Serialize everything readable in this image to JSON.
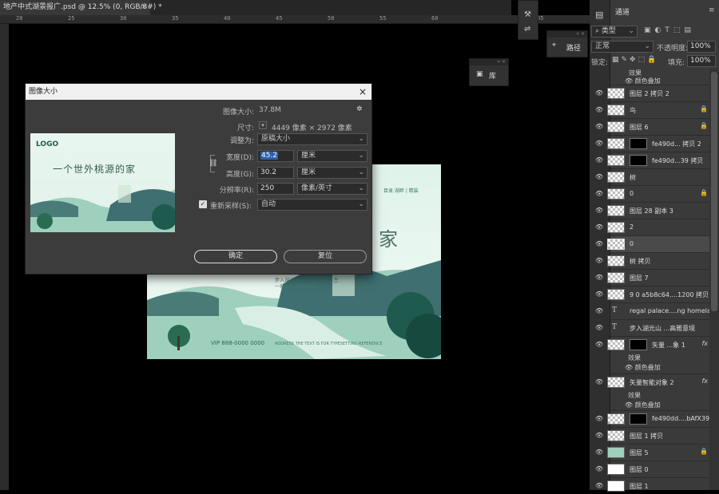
{
  "document": {
    "tab_title": "地产中式湖景报广.psd @ 12.5% (0, RGB/8#) *",
    "tab_close": "×",
    "ruler_ticks": [
      "20",
      "25",
      "30",
      "35",
      "40",
      "45",
      "50",
      "55",
      "60",
      "65"
    ],
    "artwork": {
      "title_char": "家",
      "small_lines": [
        "步入湖光山色间 尽享诗意人生",
        "一城山水 半城湖光"
      ],
      "vip_text": "VIP 888-0000 0000",
      "footer": "ADDRESS THE TEXT IS FOR TYPESETTING REFERENCE",
      "side": "目录 湖畔 | 精装"
    }
  },
  "dialog": {
    "title": "图像大小",
    "close": "×",
    "gear": "✲",
    "preview_logo": "LOGO",
    "preview_title": "一个世外桃源的家",
    "image_size_label": "图像大小:",
    "image_size_value": "37.8M",
    "dimensions_label": "尺寸:",
    "dimensions_value": "4449 像素 × 2972 像素",
    "fit_label": "调整为:",
    "fit_value": "原稿大小",
    "width_label": "宽度(D):",
    "width_value": "45.2",
    "width_unit": "厘米",
    "height_label": "高度(G):",
    "height_value": "30.2",
    "height_unit": "厘米",
    "resolution_label": "分辨率(R):",
    "resolution_value": "250",
    "resolution_unit": "像素/英寸",
    "resample_label": "重新采样(S):",
    "resample_value": "自动",
    "ok": "确定",
    "cancel": "复位"
  },
  "floating_panels": {
    "library": "库",
    "paths": "路径"
  },
  "layers_panel": {
    "title": "通道",
    "filter_kind": "类型",
    "blend_mode": "正常",
    "opacity_label": "不透明度:",
    "opacity_value": "100%",
    "lock_label": "锁定:",
    "fill_label": "填充:",
    "fill_value": "100%",
    "top_effect": "效果",
    "top_effect_item": "颜色叠加",
    "layers": [
      {
        "name": "图层 2 拷贝 2",
        "lock": false
      },
      {
        "name": "鸟",
        "lock": true
      },
      {
        "name": "图层 6",
        "lock": true
      },
      {
        "name": "fe490d... 拷贝 2",
        "lock": false,
        "mask": true
      },
      {
        "name": "fe490d...39 拷贝",
        "lock": false,
        "mask": true
      },
      {
        "name": "树",
        "lock": false
      },
      {
        "name": "0",
        "lock": true
      },
      {
        "name": "图层 28 副本 3",
        "lock": false
      },
      {
        "name": "2",
        "lock": false
      },
      {
        "name": "0",
        "lock": false,
        "selected": true
      },
      {
        "name": "树 拷贝",
        "lock": false
      },
      {
        "name": "图层 7",
        "lock": false
      },
      {
        "name": "9 0 a5b8c64....1200 拷贝 2",
        "lock": false
      },
      {
        "name": "regal palace....ng homeland",
        "text": true
      },
      {
        "name": "步入湖光山 ...高雅意境",
        "text": true
      },
      {
        "name": "矢量 ...象 1",
        "fx": true,
        "mask": true
      },
      {
        "name": "矢量智能对象 2",
        "fx": true
      },
      {
        "name": "fe490dd....bAfX39",
        "mask": true
      },
      {
        "name": "图层 1 拷贝",
        "lock": false
      },
      {
        "name": "图层 5",
        "lock": true
      },
      {
        "name": "图层 0",
        "lock": false
      },
      {
        "name": "图层 1",
        "lock": false
      }
    ],
    "effects_label": "效果",
    "color_overlay": "颜色叠加",
    "fx_glyph": "fx"
  }
}
